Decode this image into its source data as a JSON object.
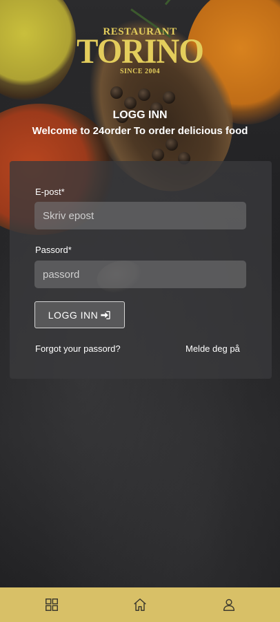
{
  "logo": {
    "line1": "RESTAURANT",
    "line2": "TORINO",
    "line3": "SINCE 2004"
  },
  "header": {
    "title": "LOGG INN",
    "subtitle": "Welcome to 24order To order delicious food"
  },
  "form": {
    "email_label": "E-post*",
    "email_placeholder": "Skriv epost",
    "email_value": "",
    "password_label": "Passord*",
    "password_placeholder": "passord",
    "password_value": "",
    "login_button": "LOGG INN",
    "forgot_link": "Forgot your passord?",
    "register_link": "Melde deg på"
  },
  "nav": {
    "items": [
      {
        "icon": "grid-icon"
      },
      {
        "icon": "home-icon"
      },
      {
        "icon": "user-icon"
      }
    ]
  },
  "colors": {
    "brand_gold": "#e3cd5c",
    "nav_bar": "#d8c067",
    "card_bg": "#3a3a3c"
  }
}
